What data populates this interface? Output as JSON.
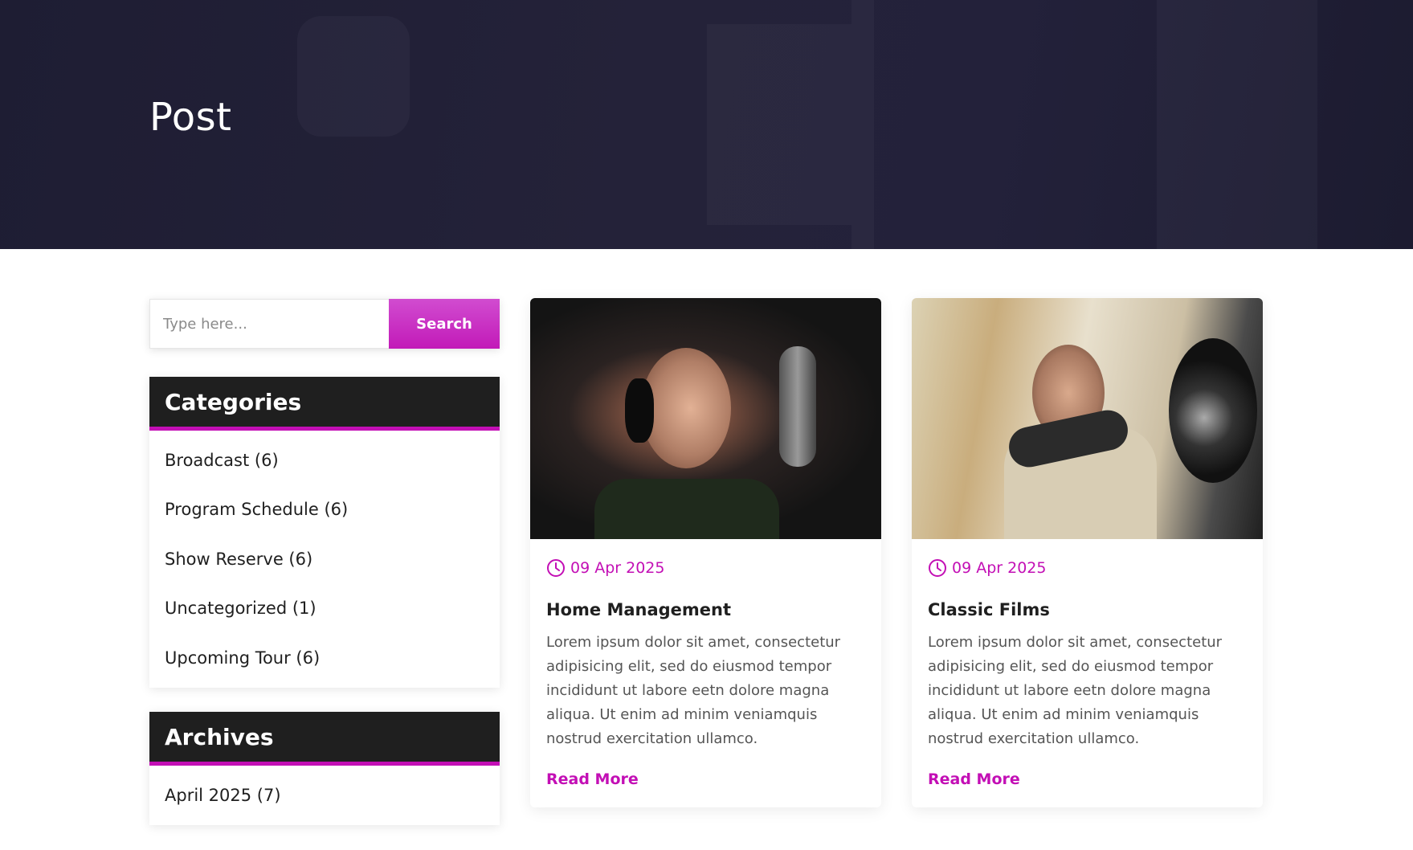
{
  "hero": {
    "title": "Post"
  },
  "search": {
    "placeholder": "Type here...",
    "button_label": "Search"
  },
  "categories": {
    "title": "Categories",
    "items": [
      {
        "label": "Broadcast (6)"
      },
      {
        "label": "Program Schedule (6)"
      },
      {
        "label": "Show Reserve (6)"
      },
      {
        "label": "Uncategorized (1)"
      },
      {
        "label": "Upcoming Tour (6)"
      }
    ]
  },
  "archives": {
    "title": "Archives",
    "items": [
      {
        "label": "April 2025 (7)"
      }
    ]
  },
  "posts": [
    {
      "date": "09 Apr 2025",
      "title": "Home Management",
      "excerpt": "Lorem ipsum dolor sit amet, consectetur adipisicing elit, sed do eiusmod tempor incididunt ut labore eetn dolore magna aliqua. Ut enim ad minim veniamquis nostrud exercitation ullamco.",
      "link_label": "Read More"
    },
    {
      "date": "09 Apr 2025",
      "title": "Classic Films",
      "excerpt": "Lorem ipsum dolor sit amet, consectetur adipisicing elit, sed do eiusmod tempor incididunt ut labore eetn dolore magna aliqua. Ut enim ad minim veniamquis nostrud exercitation ullamco.",
      "link_label": "Read More"
    }
  ],
  "colors": {
    "accent": "#c30fb5",
    "dark": "#1f1f1f",
    "hero_bg": "#222036"
  },
  "icons": {
    "date": "clock-icon"
  }
}
